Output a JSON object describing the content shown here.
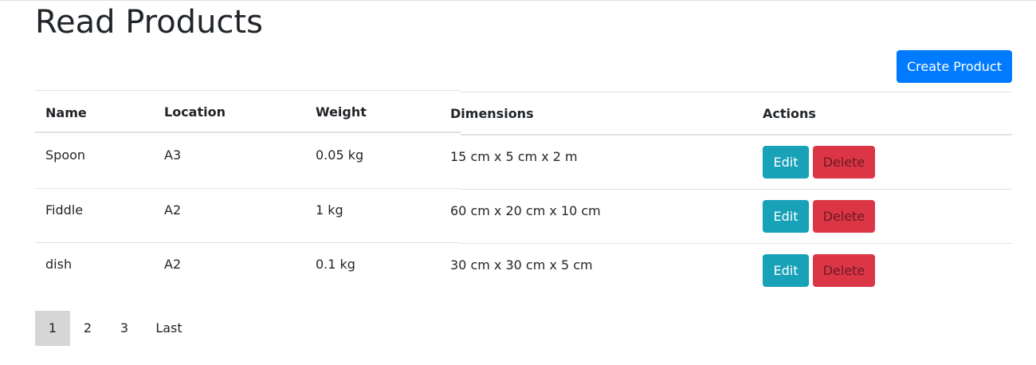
{
  "page": {
    "title": "Read Products",
    "create_button_label": "Create Product"
  },
  "table": {
    "headers": [
      "Name",
      "Location",
      "Weight",
      "Dimensions",
      "Actions"
    ],
    "rows": [
      {
        "name": "Spoon",
        "location": "A3",
        "weight": "0.05 kg",
        "dimensions": "15 cm x 5 cm x 2 m",
        "edit_label": "Edit",
        "delete_label": "Delete"
      },
      {
        "name": "Fiddle",
        "location": "A2",
        "weight": "1 kg",
        "dimensions": "60 cm x 20 cm x 10 cm",
        "edit_label": "Edit",
        "delete_label": "Delete"
      },
      {
        "name": "dish",
        "location": "A2",
        "weight": "0.1 kg",
        "dimensions": "30 cm x 30 cm x 5 cm",
        "edit_label": "Edit",
        "delete_label": "Delete"
      }
    ]
  },
  "pagination": {
    "items": [
      "1",
      "2",
      "3",
      "Last"
    ],
    "active": "1"
  },
  "colors": {
    "primary": "#007bff",
    "info": "#17a2b8",
    "danger": "#dc3545",
    "active_page": "#d6d6d6"
  }
}
